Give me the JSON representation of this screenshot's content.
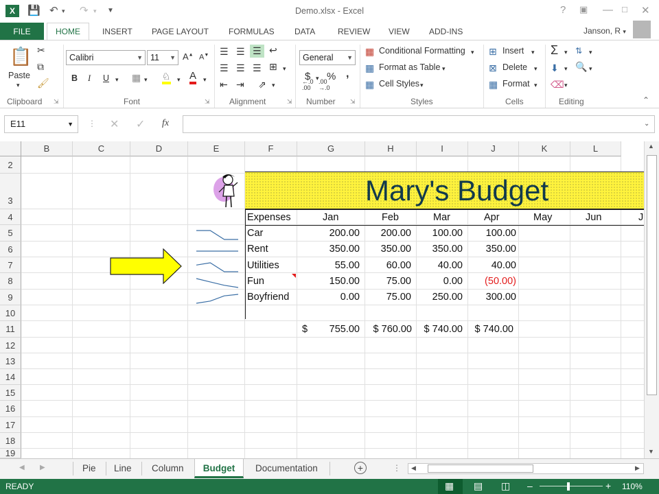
{
  "window": {
    "app_icon": "X",
    "title": "Demo.xlsx - Excel"
  },
  "ribbon_tabs": {
    "file": "FILE",
    "tabs": [
      "HOME",
      "INSERT",
      "PAGE LAYOUT",
      "FORMULAS",
      "DATA",
      "REVIEW",
      "VIEW",
      "ADD-INS"
    ],
    "user": "Janson, R"
  },
  "ribbon": {
    "clipboard": {
      "label": "Clipboard",
      "paste": "Paste"
    },
    "font": {
      "label": "Font",
      "name": "Calibri",
      "size": "11",
      "bold": "B",
      "italic": "I",
      "underline": "U"
    },
    "alignment": {
      "label": "Alignment"
    },
    "number": {
      "label": "Number",
      "format": "General",
      "currency": "$",
      "percent": "%",
      "comma": ","
    },
    "styles": {
      "label": "Styles",
      "conditional": "Conditional Formatting",
      "format_table": "Format as Table",
      "cell_styles": "Cell Styles"
    },
    "cells": {
      "label": "Cells",
      "insert": "Insert",
      "delete": "Delete",
      "format": "Format"
    },
    "editing": {
      "label": "Editing"
    }
  },
  "formula_bar": {
    "name_box": "E11",
    "fx": "fx",
    "value": ""
  },
  "columns": [
    "B",
    "C",
    "D",
    "E",
    "F",
    "G",
    "H",
    "I",
    "J",
    "K",
    "L"
  ],
  "rows": [
    "2",
    "3",
    "4",
    "5",
    "6",
    "7",
    "8",
    "9",
    "10",
    "11",
    "12",
    "13",
    "14",
    "15",
    "16",
    "17",
    "18",
    "19"
  ],
  "sheet": {
    "title": "Mary's Budget",
    "header": [
      "Expenses",
      "Jan",
      "Feb",
      "Mar",
      "Apr",
      "May",
      "Jun",
      "J"
    ],
    "expenses": [
      {
        "name": "Car",
        "values": [
          "200.00",
          "200.00",
          "100.00",
          "100.00"
        ],
        "trend": [
          200,
          200,
          100,
          100
        ]
      },
      {
        "name": "Rent",
        "values": [
          "350.00",
          "350.00",
          "350.00",
          "350.00"
        ],
        "trend": [
          350,
          350,
          350,
          350
        ]
      },
      {
        "name": "Utilities",
        "values": [
          "55.00",
          "60.00",
          "40.00",
          "40.00"
        ],
        "trend": [
          55,
          60,
          40,
          40
        ]
      },
      {
        "name": "Fun",
        "values": [
          "150.00",
          "75.00",
          "0.00",
          "(50.00)"
        ],
        "trend": [
          150,
          75,
          0,
          -50
        ]
      },
      {
        "name": "Boyfriend",
        "values": [
          "0.00",
          "75.00",
          "250.00",
          "300.00"
        ],
        "trend": [
          0,
          75,
          250,
          300
        ]
      }
    ],
    "totals": {
      "currency": "$",
      "jan": "755.00",
      "feb": "$ 760.00",
      "mar": "$ 740.00",
      "apr": "$ 740.00"
    }
  },
  "sheet_tabs": [
    "Pie",
    "Line",
    "Column",
    "Budget",
    "Documentation"
  ],
  "status": {
    "ready": "READY",
    "zoom": "110%"
  },
  "colors": {
    "excel_green": "#217346",
    "banner_yellow": "#fff33d",
    "arrow_yellow": "#ffff00",
    "negative_red": "#e31b1b",
    "sparkline": "#3a6ea5"
  }
}
